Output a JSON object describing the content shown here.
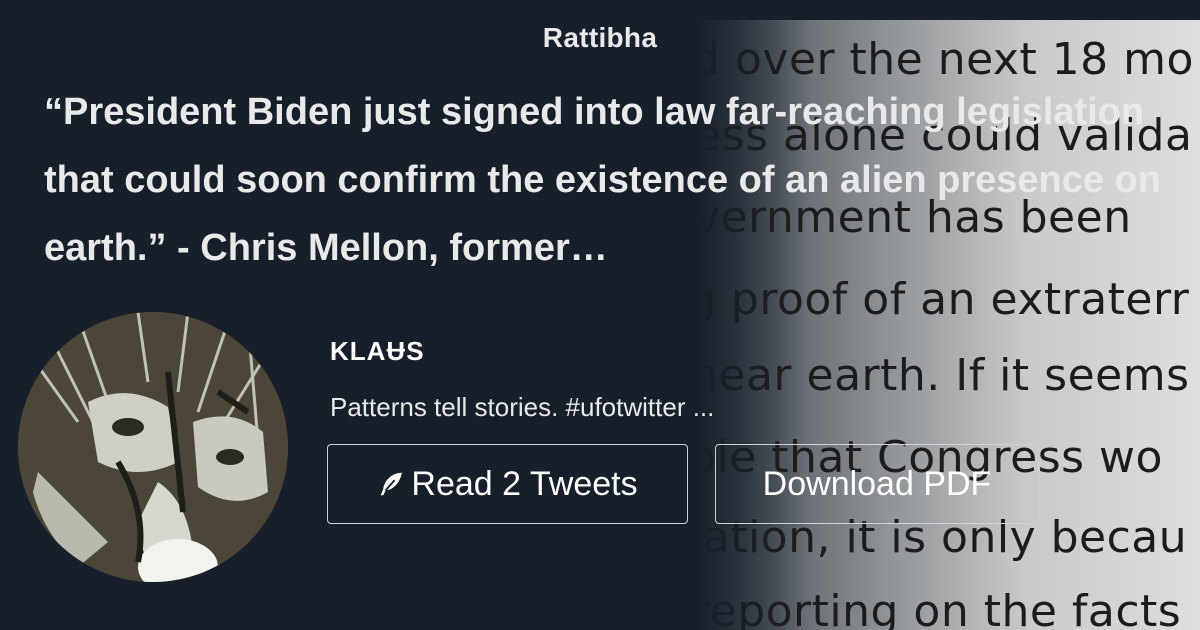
{
  "brand": "Rattibha",
  "headline": "“President Biden just signed into law far-reaching legislation that could soon confirm the existence of an alien presence on earth.” - Chris Mellon, former…",
  "author": {
    "name": "KLAɄS",
    "bio": "Patterns tell stories. #ufotwitter ..."
  },
  "buttons": {
    "read_label": "Read 2 Tweets",
    "pdf_label": "Download PDF"
  },
  "background_text": [
    "d over the next 18 mo",
    "ess alone could valida",
    "vernment has been",
    "g proof of an extraterr",
    "near earth. If it seems",
    "ble that Congress wo",
    "lation, it is only becau",
    "reporting on the facts"
  ],
  "icons": {
    "read": "feather-icon"
  }
}
